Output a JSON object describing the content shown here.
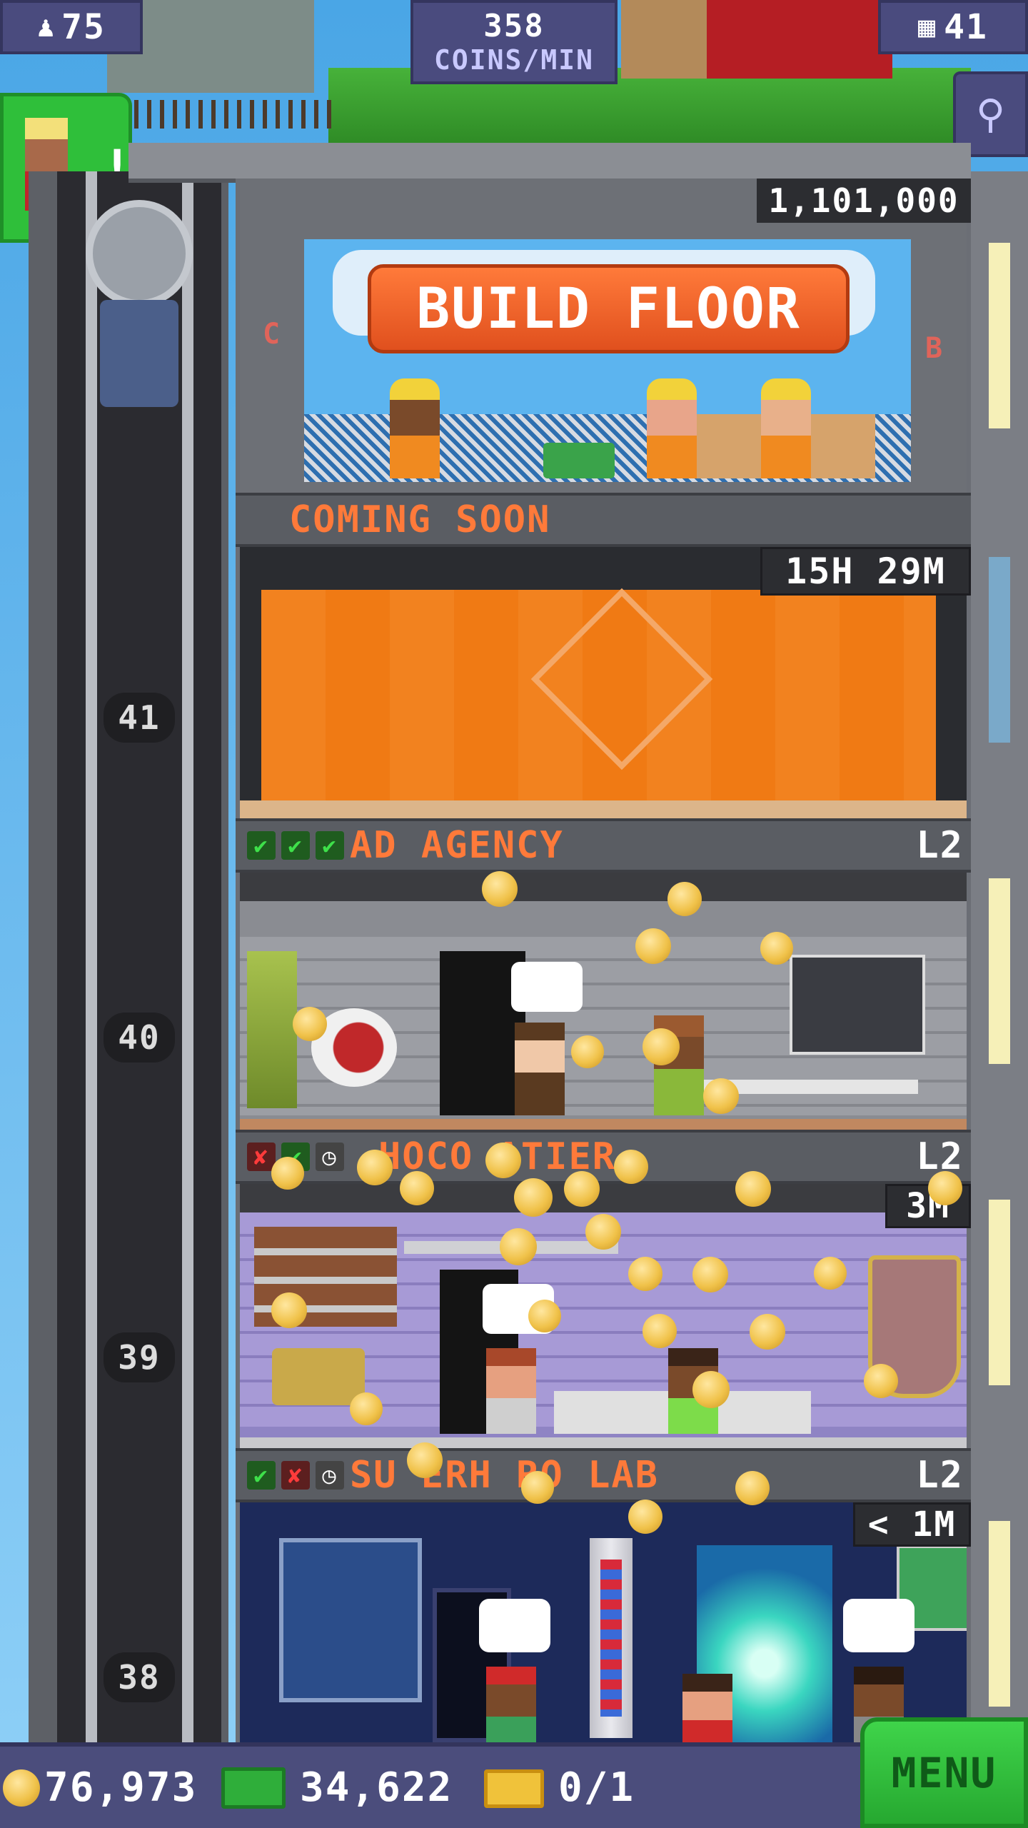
{
  "hud": {
    "population": "75",
    "coins_rate_value": "358",
    "coins_rate_label": "COINS/MIN",
    "floors": "41"
  },
  "build": {
    "cost": "1,101,000",
    "button_label": "BUILD FLOOR",
    "left_marker": "C",
    "right_marker": "B"
  },
  "floors": [
    {
      "name": "COMING SOON",
      "timer": "15H 29M",
      "level": "",
      "statuses": []
    },
    {
      "name": "AD AGENCY",
      "timer": "",
      "level": "L2",
      "statuses": [
        "check",
        "check",
        "check"
      ]
    },
    {
      "name": "CHOCOLATIER",
      "timer": "3M",
      "level": "L2",
      "statuses": [
        "cross",
        "check",
        "clock"
      ]
    },
    {
      "name": "SUPERHERO LAB",
      "timer": "< 1M",
      "level": "L2",
      "statuses": [
        "check",
        "cross",
        "clock"
      ]
    }
  ],
  "chocolatier_visible_label": "HOCO ATIER",
  "superhero_visible_label": "SU ERH RO LAB",
  "elevator_floor_numbers": [
    "41",
    "40",
    "39",
    "38"
  ],
  "bottom": {
    "coins": "76,973",
    "bux": "34,622",
    "tickets": "0/1",
    "menu_label": "MENU"
  },
  "colors": {
    "hud_purple": "#4a4b7e",
    "orange_label": "#ff7a3a",
    "build_button": "#f0602a",
    "menu_green": "#2fbf3a",
    "check_green": "#3ee04a",
    "cross_red": "#ff3b3b"
  }
}
